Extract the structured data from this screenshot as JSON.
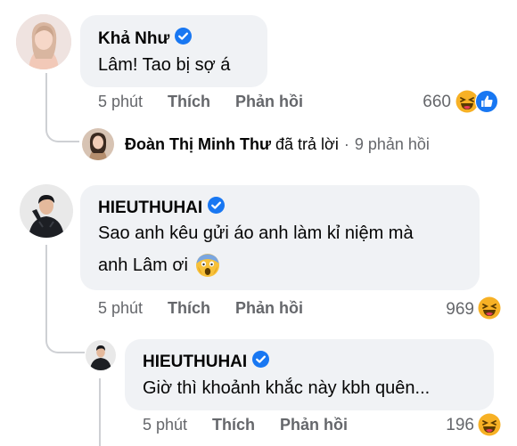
{
  "comments": [
    {
      "author": "Khả Như",
      "text": "Lâm! Tao bị sợ á",
      "time": "5 phút",
      "like_label": "Thích",
      "reply_label": "Phản hồi",
      "reaction_count": "660",
      "reactions": [
        "haha-emoji",
        "like-icon"
      ]
    },
    {
      "author": "HIEUTHUHAI",
      "text_line1": "Sao anh kêu gửi áo anh làm kỉ niệm mà",
      "text_line2": "anh Lâm ơi",
      "time": "5 phút",
      "like_label": "Thích",
      "reply_label": "Phản hồi",
      "reaction_count": "969",
      "reactions": [
        "haha-emoji"
      ]
    }
  ],
  "replies_summary": {
    "author": "Đoàn Thị Minh Thư",
    "action": "đã trả lời",
    "count": "9 phản hồi"
  },
  "reply": {
    "author": "HIEUTHUHAI",
    "text": "Giờ thì khoảnh khắc này kbh quên...",
    "time": "5 phút",
    "like_label": "Thích",
    "reply_label": "Phản hồi",
    "reaction_count": "196",
    "reactions": [
      "haha-emoji"
    ]
  },
  "colors": {
    "bubble": "#f0f2f5",
    "meta_text": "#65676b",
    "verified": "#1877f2",
    "like": "#1877f2",
    "haha": "#f7b125",
    "thread_line": "#ced0d4"
  }
}
